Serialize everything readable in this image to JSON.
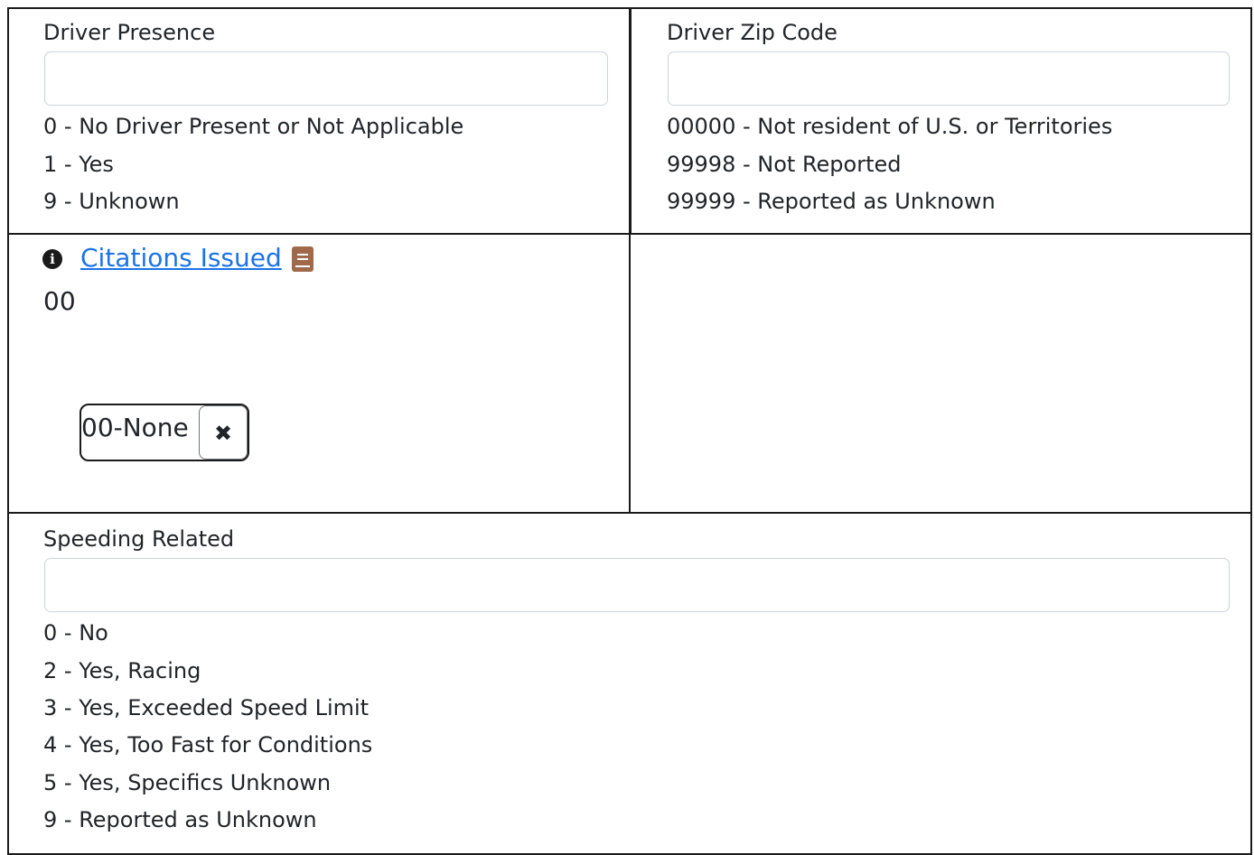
{
  "driver_presence": {
    "label": "Driver Presence",
    "value": "",
    "options": [
      "0 - No Driver Present or Not Applicable",
      "1 - Yes",
      "9 - Unknown"
    ]
  },
  "driver_zip": {
    "label": "Driver Zip Code",
    "value": "",
    "options": [
      "00000 - Not resident of U.S. or Territories",
      "99998 - Not Reported",
      "99999 - Reported as Unknown"
    ]
  },
  "citations": {
    "link_label": "Citations Issued",
    "value": "00",
    "chip_label": "00-None",
    "chip_remove_glyph": "✖",
    "info_glyph": "i"
  },
  "speeding": {
    "label": "Speeding Related",
    "value": "",
    "options": [
      "0 - No",
      "2 - Yes, Racing",
      "3 - Yes, Exceeded Speed Limit",
      "4 - Yes, Too Fast for Conditions",
      "5 - Yes, Specifics Unknown",
      "9 - Reported as Unknown"
    ]
  },
  "colors": {
    "link": "#1a73e8",
    "book_icon": "#a0694a",
    "border": "#1a1a1a"
  }
}
